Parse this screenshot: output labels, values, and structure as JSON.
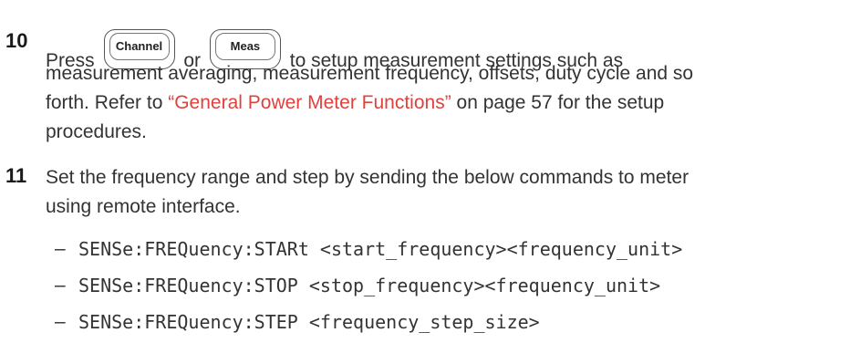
{
  "step10": {
    "number": "10",
    "press": "Press",
    "key1": "Channel",
    "or": "or",
    "key2": "Meas",
    "line1_rest": "to setup measurement settings such as",
    "line2": "measurement averaging, measurement frequency, offsets, duty cycle and so",
    "line3_start": "forth. Refer to ",
    "link": "“General Power Meter Functions”",
    "line3_end": " on page 57 for the setup",
    "line4": "procedures."
  },
  "step11": {
    "number": "11",
    "line1": "Set the frequency range and step by sending the below commands to meter",
    "line2": "using remote interface.",
    "bullet": "–",
    "commands": [
      "SENSe:FREQuency:STARt <start_frequency><frequency_unit>",
      "SENSe:FREQuency:STOP <stop_frequency><frequency_unit>",
      "SENSe:FREQuency:STEP <frequency_step_size>"
    ]
  }
}
